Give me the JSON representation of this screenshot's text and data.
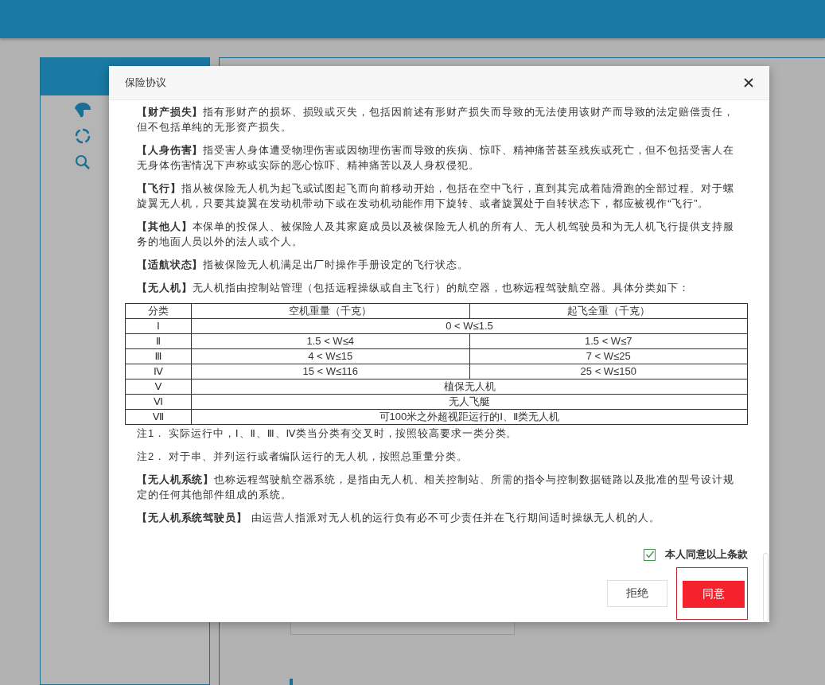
{
  "dialog": {
    "title": "保险协议",
    "blocks": [
      {
        "kind": "paragraph",
        "text": "**【财产损失】**指有形财产的损坏、损毁或灭失，包括因前述有形财产损失而导致的无法使用该财产而导致的法定赔偿责任，但不包括单纯的无形资产损失。"
      },
      {
        "kind": "paragraph",
        "text": "**【人身伤害】**指受害人身体遭受物理伤害或因物理伤害而导致的疾病、惊吓、精神痛苦甚至残疾或死亡，但不包括受害人在无身体伤害情况下声称或实际的恶心惊吓、精神痛苦以及人身权侵犯。"
      },
      {
        "kind": "paragraph",
        "text": "**【飞行】**指从被保险无人机为起飞或试图起飞而向前移动开始，包括在空中飞行，直到其完成着陆滑跑的全部过程。对于螺旋翼无人机，只要其旋翼在发动机带动下或在发动机动能作用下旋转、或者旋翼处于自转状态下，都应被视作“飞行”。"
      },
      {
        "kind": "paragraph",
        "text": "**【其他人】**本保单的投保人、被保险人及其家庭成员以及被保险无人机的所有人、无人机驾驶员和为无人机飞行提供支持服务的地面人员以外的法人或个人。"
      },
      {
        "kind": "paragraph",
        "text": "**【适航状态】**指被保险无人机满足出厂时操作手册设定的飞行状态。"
      },
      {
        "kind": "paragraph",
        "text": "**【无人机】**无人机指由控制站管理（包括远程操纵或自主飞行）的航空器，也称远程驾驶航空器。具体分类如下："
      },
      {
        "kind": "table",
        "columns": [
          "分类",
          "空机重量（千克）",
          "起飞全重（千克）"
        ],
        "rows": [
          {
            "cells": [
              {
                "text": "Ⅰ"
              },
              {
                "text": "0 < W≤1.5",
                "colspan": 2
              }
            ]
          },
          {
            "cells": [
              {
                "text": "Ⅱ"
              },
              {
                "text": "1.5 < W≤4"
              },
              {
                "text": "1.5 < W≤7"
              }
            ]
          },
          {
            "cells": [
              {
                "text": "Ⅲ"
              },
              {
                "text": "4 < W≤15"
              },
              {
                "text": "7 < W≤25"
              }
            ]
          },
          {
            "cells": [
              {
                "text": "Ⅳ"
              },
              {
                "text": "15 < W≤116"
              },
              {
                "text": "25 < W≤150"
              }
            ]
          },
          {
            "cells": [
              {
                "text": "Ⅴ"
              },
              {
                "text": "植保无人机",
                "colspan": 2
              }
            ]
          },
          {
            "cells": [
              {
                "text": "Ⅵ"
              },
              {
                "text": "无人飞艇",
                "colspan": 2
              }
            ]
          },
          {
            "cells": [
              {
                "text": "Ⅶ"
              },
              {
                "text": "可100米之外超视距运行的Ⅰ、Ⅱ类无人机",
                "colspan": 2
              }
            ]
          }
        ]
      },
      {
        "kind": "note",
        "text": "注1． 实际运行中，Ⅰ、Ⅱ、Ⅲ、Ⅳ类当分类有交叉时，按照较高要求一类分类。"
      },
      {
        "kind": "paragraph",
        "text": "注2． 对于串、并列运行或者编队运行的无人机，按照总重量分类。"
      },
      {
        "kind": "paragraph",
        "text": "**【无人机系统】**也称远程驾驶航空器系统，是指由无人机、相关控制站、所需的指令与控制数据链路以及批准的型号设计规定的任何其他部件组成的系统。"
      },
      {
        "kind": "paragraph",
        "text": "**【无人机系统驾驶员】** 由运营人指派对无人机的运行负有必不可少责任并在飞行期间适时操纵无人机的人。"
      }
    ],
    "agree": {
      "label": "本人同意以上条款",
      "checked": true
    },
    "buttons": [
      {
        "label": "拒绝",
        "kind": "default",
        "focused": false
      },
      {
        "label": "同意",
        "kind": "primary",
        "focused": true
      }
    ]
  }
}
